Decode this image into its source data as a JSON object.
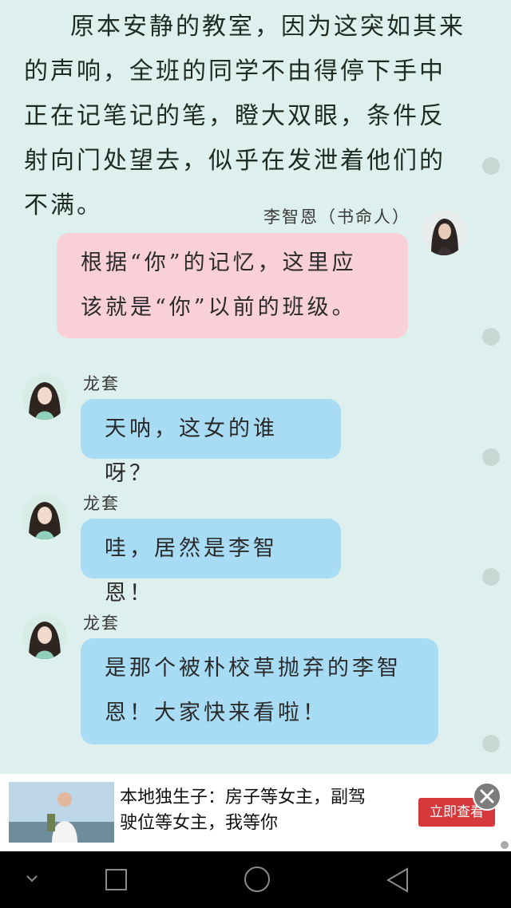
{
  "story": {
    "narration": "原本安静的教室，因为这突如其来的声响，全班的同学不由得停下手中正在记笔记的笔，瞪大双眼，条件反射向门处望去，似乎在发泄着他们的不满。"
  },
  "messages": [
    {
      "speaker": "李智恩（书命人）",
      "text_lines": [
        "根据“你”的记忆，这里应",
        "该就是“你”以前的班级。"
      ],
      "side": "right",
      "color": "#f9cfd8"
    },
    {
      "speaker": "龙套",
      "text_lines": [
        "天呐，这女的谁呀？"
      ],
      "side": "left",
      "color": "#a8dcf5"
    },
    {
      "speaker": "龙套",
      "text_lines": [
        "哇，居然是李智恩！"
      ],
      "side": "left",
      "color": "#a8dcf5"
    },
    {
      "speaker": "龙套",
      "text_lines": [
        "是那个被朴校草抛弃的李智",
        "恩！大家快来看啦！"
      ],
      "side": "left",
      "color": "#a8dcf5"
    }
  ],
  "ad": {
    "line1": "本地独生子：房子等女主，副驾",
    "line2": "驶位等女主，我等你",
    "cta": "立即查看",
    "close_icon": "close-icon"
  },
  "navbar": {
    "icons": [
      "chevron-down-icon",
      "recent-apps-icon",
      "home-icon",
      "back-icon"
    ]
  }
}
